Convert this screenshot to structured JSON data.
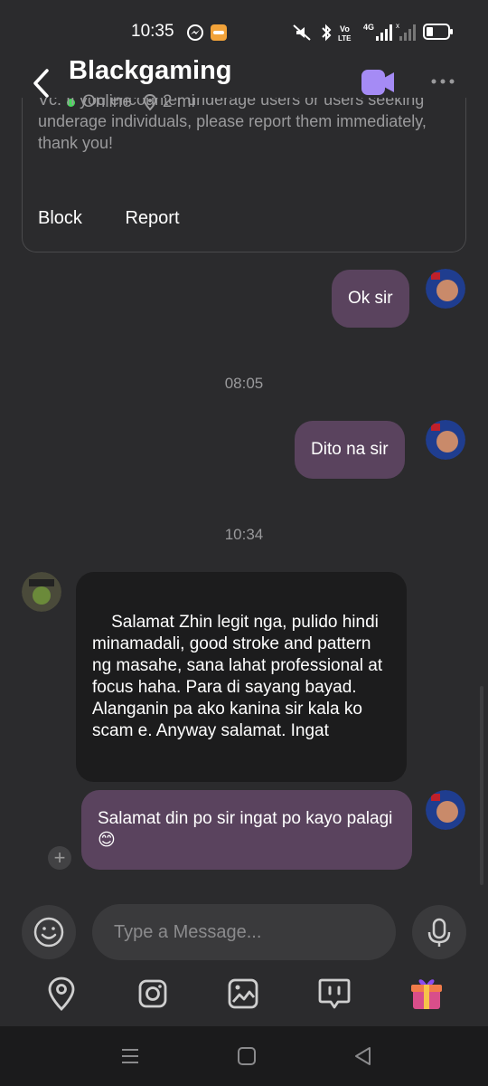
{
  "status_bar": {
    "time": "10:35",
    "icons": [
      "messenger-icon",
      "app-badge-icon",
      "mute-icon",
      "bluetooth-icon",
      "volte-icon",
      "signal-4g-icon",
      "signal-icon",
      "battery-icon"
    ],
    "network": "4G"
  },
  "header": {
    "title": "Blackgaming",
    "presence": "Online",
    "distance": "2 mi",
    "online_color": "#47d85b",
    "accent": "#a58bf5"
  },
  "notice": {
    "text": "Vc. If you encounter underage users or users seeking underage individuals, please report them immediately, thank you!",
    "block_label": "Block",
    "report_label": "Report"
  },
  "messages": [
    {
      "type": "out",
      "text": "Ok sir"
    },
    {
      "type": "time",
      "text": "08:05"
    },
    {
      "type": "out",
      "text": "Dito na sir"
    },
    {
      "type": "time",
      "text": "10:34"
    },
    {
      "type": "in",
      "text": "Salamat Zhin legit nga, pulido hindi minamadali, good stroke and pattern ng masahe, sana lahat professional at focus haha. Para di sayang bayad.\nAlanganin pa ako kanina sir kala ko scam e. Anyway salamat. Ingat"
    },
    {
      "type": "out",
      "text": "Salamat din po sir ingat po kayo palagi 😊"
    }
  ],
  "composer": {
    "placeholder": "Type a Message..."
  },
  "toolbar": [
    "location-icon",
    "instagram-icon",
    "gallery-icon",
    "quick-reply-icon",
    "gift-icon"
  ],
  "colors": {
    "background": "#2b2b2d",
    "outgoing_bubble": "#5a435e",
    "incoming_bubble": "#1c1c1d"
  }
}
